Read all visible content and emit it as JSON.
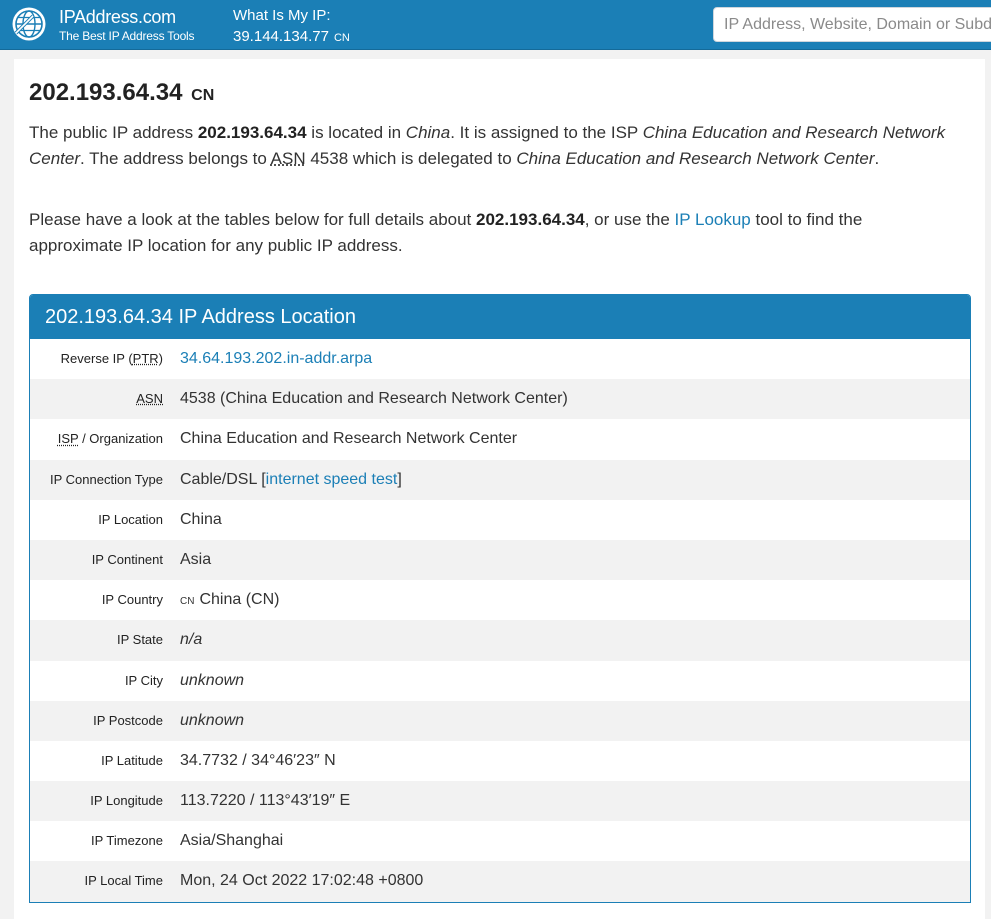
{
  "header": {
    "brand_name": "IPAddress.com",
    "brand_tagline": "The Best IP Address Tools",
    "myip_label": "What Is My IP:",
    "myip_value": "39.144.134.77",
    "myip_country": "CN",
    "search_placeholder": "IP Address, Website, Domain or Subdomain"
  },
  "main": {
    "title_ip": "202.193.64.34",
    "title_country": "CN",
    "p1": {
      "t1": "The public IP address ",
      "ip": "202.193.64.34",
      "t2": " is located in ",
      "country": "China",
      "t3": ". It is assigned to the ISP ",
      "isp": "China Education and Research Network Center",
      "t4": ". The address belongs to ",
      "asn_abbr": "ASN",
      "t5": " 4538 which is delegated to ",
      "org": "China Education and Research Network Center",
      "t6": "."
    },
    "p2": {
      "t1": "Please have a look at the tables below for full details about ",
      "ip": "202.193.64.34",
      "t2": ", or use the ",
      "link": "IP Lookup",
      "t3": " tool to find the approximate IP location for any public IP address."
    }
  },
  "location_table": {
    "header": "202.193.64.34 IP Address Location",
    "rows": {
      "reverse_ip": {
        "label_pre": "Reverse IP (",
        "label_abbr": "PTR",
        "label_post": ")",
        "value": "34.64.193.202.in-addr.arpa"
      },
      "asn": {
        "label_abbr": "ASN",
        "value": "4538 (China Education and Research Network Center)"
      },
      "isp": {
        "label_abbr": "ISP",
        "label_post": " / Organization",
        "value": "China Education and Research Network Center"
      },
      "connection_type": {
        "label": "IP Connection Type",
        "value": "Cable/DSL",
        "bracket_open": " [",
        "link": "internet speed test",
        "bracket_close": "]"
      },
      "location": {
        "label": "IP Location",
        "value": "China"
      },
      "continent": {
        "label": "IP Continent",
        "value": "Asia"
      },
      "country": {
        "label": "IP Country",
        "cc": "CN",
        "value": "China (CN)"
      },
      "state": {
        "label": "IP State",
        "value": "n/a"
      },
      "city": {
        "label": "IP City",
        "value": "unknown"
      },
      "postcode": {
        "label": "IP Postcode",
        "value": "unknown"
      },
      "latitude": {
        "label": "IP Latitude",
        "value": "34.7732 / 34°46′23″ N"
      },
      "longitude": {
        "label": "IP Longitude",
        "value": "113.7220 / 113°43′19″ E"
      },
      "timezone": {
        "label": "IP Timezone",
        "value": "Asia/Shanghai"
      },
      "local_time": {
        "label": "IP Local Time",
        "value": "Mon, 24 Oct 2022 17:02:48 +0800"
      }
    }
  },
  "colors": {
    "brand_blue": "#1b7fb6",
    "stripe": "#f2f2f2"
  },
  "icons": {
    "logo": "globe-logo-icon"
  }
}
